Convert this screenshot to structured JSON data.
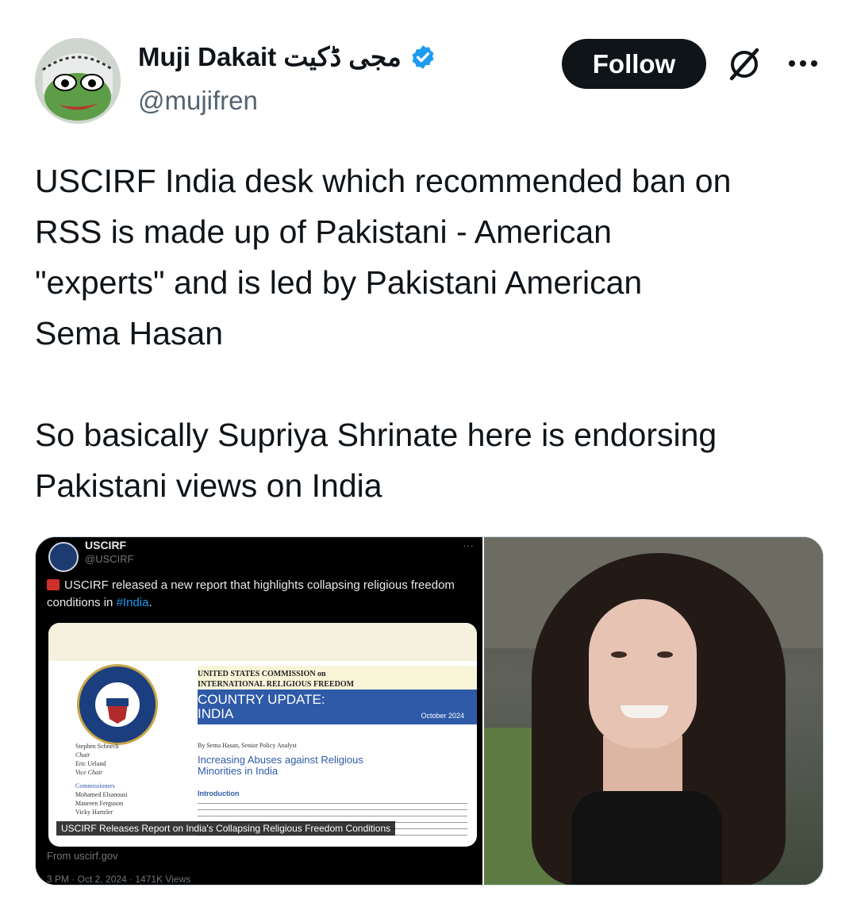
{
  "header": {
    "display_name": "Muji Dakait مجی ڈکیت",
    "handle": "@mujifren",
    "verified": true,
    "follow_label": "Follow",
    "accent_color": "#1d9bf0"
  },
  "tweet": {
    "text": "USCIRF India desk which recommended ban on\nRSS is made up of Pakistani - American\n\"experts\" and is led by Pakistani American\nSema Hasan\n\nSo basically Supriya Shrinate here is endorsing\nPakistani views on India"
  },
  "media": {
    "embedded_post": {
      "name": "USCIRF",
      "handle": "@USCIRF",
      "more": "···",
      "text_before": "USCIRF released a new report that highlights collapsing religious freedom conditions in ",
      "hashtag": "#India",
      "text_after": ".",
      "report": {
        "commission_line1": "UNITED STATES COMMISSION on",
        "commission_line2": "INTERNATIONAL RELIGIOUS FREEDOM",
        "band_title_line1": "COUNTRY UPDATE:",
        "band_title_line2": "INDIA",
        "date": "October 2024",
        "people": [
          "Stephen Schneck",
          "Chair",
          "Eric Ueland",
          "Vice Chair",
          "Commissioners",
          "Mohamed Elsanousi",
          "Maureen Ferguson",
          "Vicky Hartzler"
        ],
        "author": "By Sema Hasan, Senior Policy Analyst",
        "subtitle": "Increasing Abuses against Religious Minorities in India",
        "intro_heading": "Introduction"
      },
      "caption": "USCIRF Releases Report on India's Collapsing Religious Freedom Conditions",
      "from": "From uscirf.gov",
      "stats": "3 PM · Oct 2, 2024 · 1471K Views"
    },
    "photo_alt": "portrait-photo"
  },
  "icons": {
    "verified": "verified-badge-icon",
    "grok": "grok-icon",
    "more": "more-icon"
  }
}
